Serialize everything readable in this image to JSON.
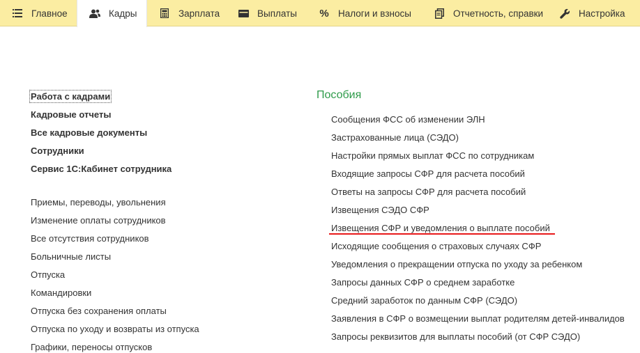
{
  "top_menu": {
    "items": [
      {
        "label": "Главное",
        "icon": "hamburger-icon"
      },
      {
        "label": "Кадры",
        "icon": "people-icon",
        "active": true
      },
      {
        "label": "Зарплата",
        "icon": "calculator-icon"
      },
      {
        "label": "Выплаты",
        "icon": "wallet-icon"
      },
      {
        "label": "Налоги и взносы",
        "icon": "percent-icon"
      },
      {
        "label": "Отчетность, справки",
        "icon": "documents-icon"
      },
      {
        "label": "Настройка",
        "icon": "wrench-icon"
      }
    ]
  },
  "hr_section": {
    "bold_links": [
      "Работа с кадрами",
      "Кадровые отчеты",
      "Все кадровые документы",
      "Сотрудники",
      "Сервис 1С:Кабинет сотрудника"
    ],
    "links": [
      "Приемы, переводы, увольнения",
      "Изменение оплаты сотрудников",
      "Все отсутствия сотрудников",
      "Больничные листы",
      "Отпуска",
      "Командировки",
      "Отпуска без сохранения оплаты",
      "Отпуска по уходу и возвраты из отпуска",
      "Графики, переносы отпусков"
    ]
  },
  "benefits_section": {
    "title": "Пособия",
    "links": [
      "Сообщения ФСС об изменении ЭЛН",
      "Застрахованные лица (СЭДО)",
      "Настройки прямых выплат ФСС по сотрудникам",
      "Входящие запросы СФР для расчета пособий",
      "Ответы на запросы СФР для расчета пособий",
      "Извещения СЭДО СФР",
      "Извещения СФР и уведомления о выплате пособий",
      "Исходящие сообщения о страховых случаях СФР",
      "Уведомления о прекращении отпуска по уходу за ребенком",
      "Запросы данных СФР о среднем заработке",
      "Средний заработок по данным СФР (СЭДО)",
      "Заявления в СФР о возмещении выплат родителям детей-инвалидов",
      "Запросы реквизитов для выплаты пособий (от СФР СЭДО)"
    ]
  },
  "colors": {
    "menu_bar": "#fbeda2",
    "section_title": "#2e9b4a",
    "highlight_underline": "#e8191b"
  }
}
